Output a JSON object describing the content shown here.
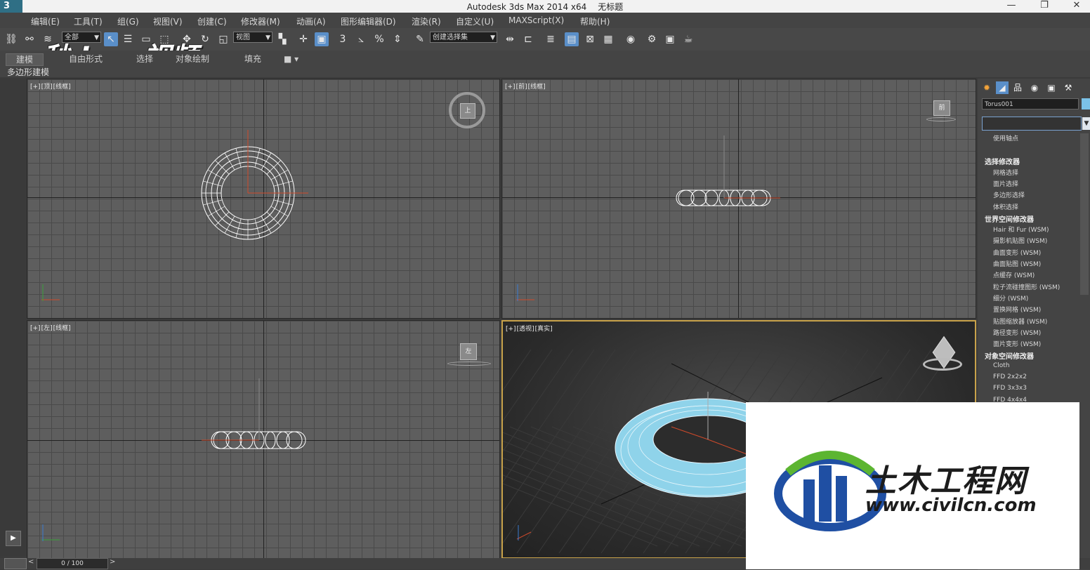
{
  "window": {
    "app_title": "Autodesk 3ds Max  2014 x64",
    "doc_title": "无标题",
    "minimize": "—",
    "restore": "❐",
    "close": "✕",
    "app_icon": "3"
  },
  "menu": [
    "编辑(E)",
    "工具(T)",
    "组(G)",
    "视图(V)",
    "创建(C)",
    "修改器(M)",
    "动画(A)",
    "图形编辑器(D)",
    "渲染(R)",
    "自定义(U)",
    "MAXScript(X)",
    "帮助(H)"
  ],
  "toolbar": {
    "selection_filter": "全部",
    "reference_coord": "视图",
    "named_selection": "创建选择集",
    "snap_3": "3",
    "percent_snap": "%"
  },
  "ribbon": {
    "tabs": [
      "建模",
      "自由形式",
      "选择",
      "对象绘制",
      "填充"
    ],
    "sub_label": "多边形建模"
  },
  "watermark_top": "秒dong视频",
  "viewports": {
    "top": {
      "l1": "[+]",
      "l2": "[顶]",
      "l3": "[线框]",
      "cube": "上"
    },
    "front": {
      "l1": "[+]",
      "l2": "[前]",
      "l3": "[线框]",
      "cube": "前"
    },
    "left": {
      "l1": "[+]",
      "l2": "[左]",
      "l3": "[线框]",
      "cube": "左"
    },
    "persp": {
      "l1": "[+]",
      "l2": "[透视]",
      "l3": "[真实]"
    }
  },
  "command_panel": {
    "object_name": "Torus001",
    "object_color": "#7bc2e8",
    "dropdown_items": [
      {
        "text": "使用轴点",
        "head": false
      },
      {
        "text": "选择修改器",
        "head": true
      },
      {
        "text": "网格选择",
        "head": false
      },
      {
        "text": "面片选择",
        "head": false
      },
      {
        "text": "多边形选择",
        "head": false
      },
      {
        "text": "体积选择",
        "head": false
      },
      {
        "text": "世界空间修改器",
        "head": true
      },
      {
        "text": "Hair 和 Fur (WSM)",
        "head": false
      },
      {
        "text": "摄影机贴图 (WSM)",
        "head": false
      },
      {
        "text": "曲面变形 (WSM)",
        "head": false
      },
      {
        "text": "曲面贴图 (WSM)",
        "head": false
      },
      {
        "text": "点缓存 (WSM)",
        "head": false
      },
      {
        "text": "粒子流碰撞图形 (WSM)",
        "head": false
      },
      {
        "text": "细分 (WSM)",
        "head": false
      },
      {
        "text": "置换网格 (WSM)",
        "head": false
      },
      {
        "text": "贴图缩放器 (WSM)",
        "head": false
      },
      {
        "text": "路径变形 (WSM)",
        "head": false
      },
      {
        "text": "面片变形 (WSM)",
        "head": false
      },
      {
        "text": "对象空间修改器",
        "head": true
      },
      {
        "text": "Cloth",
        "head": false
      },
      {
        "text": "FFD 2x2x2",
        "head": false
      },
      {
        "text": "FFD 3x3x3",
        "head": false
      },
      {
        "text": "FFD 4x4x4",
        "head": false
      }
    ]
  },
  "timeline": {
    "frame": "0 / 100"
  },
  "logo": {
    "cn": "土木工程网",
    "url": "www.civilcn.com"
  }
}
